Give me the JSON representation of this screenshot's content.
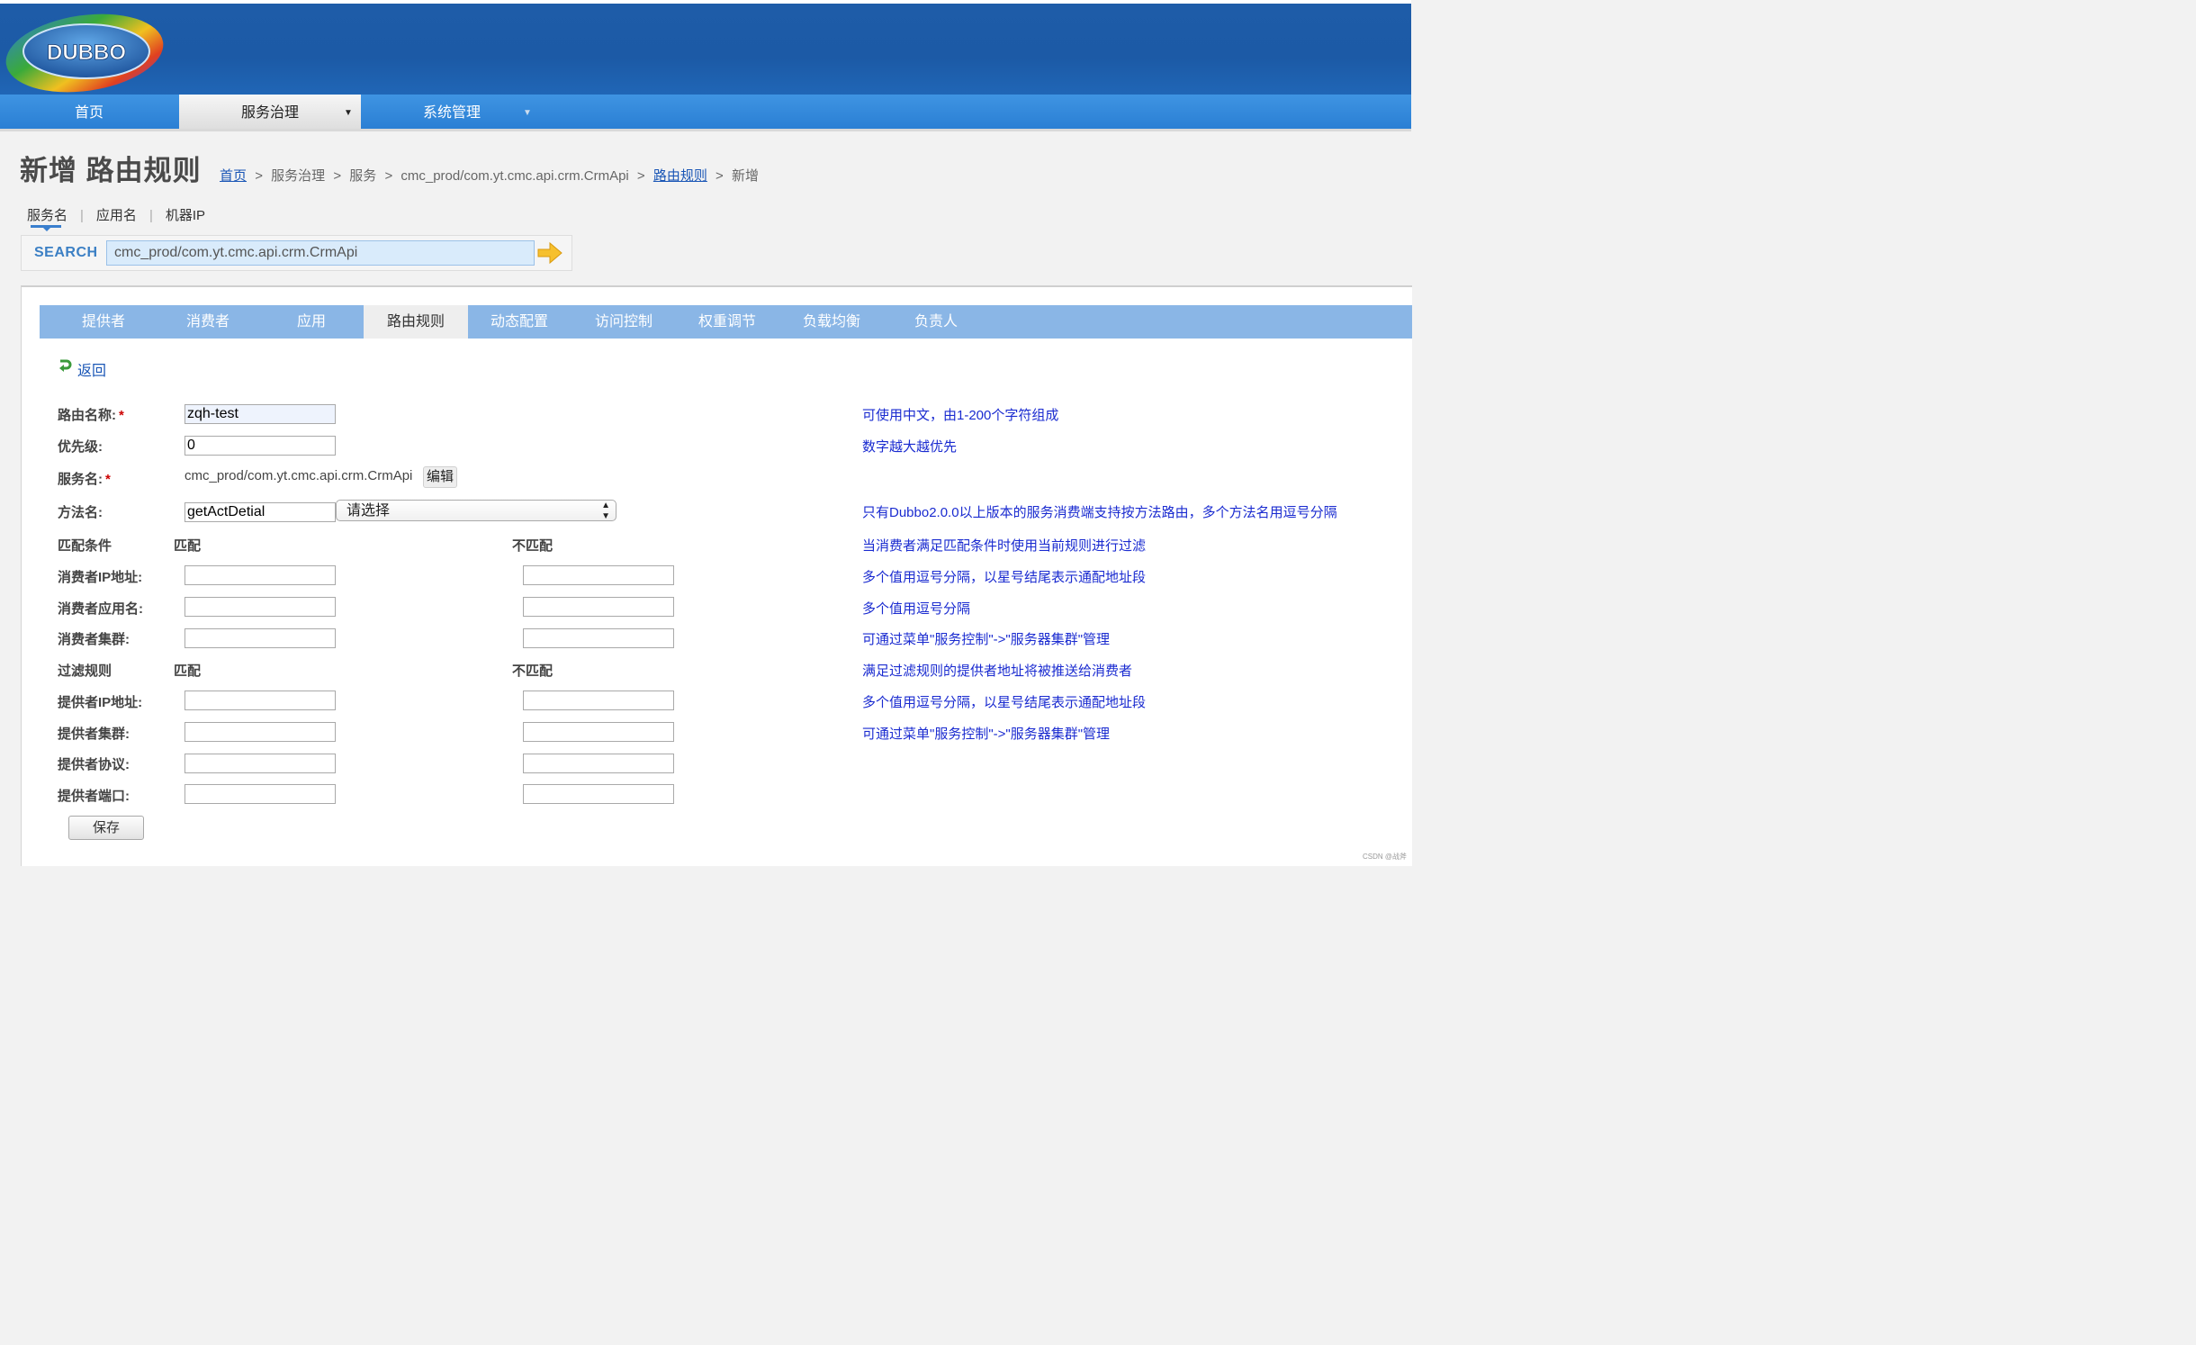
{
  "brand": {
    "logo_text": "DUBBO"
  },
  "nav": {
    "items": [
      {
        "label": "首页"
      },
      {
        "label": "服务治理"
      },
      {
        "label": "系统管理"
      }
    ]
  },
  "page": {
    "title": "新增 路由规则"
  },
  "breadcrumb": {
    "home": "首页",
    "governance": "服务治理",
    "service": "服务",
    "service_path": "cmc_prod/com.yt.cmc.api.crm.CrmApi",
    "routes": "路由规则",
    "current": "新增",
    "separator": ">"
  },
  "search": {
    "tabs": [
      "服务名",
      "应用名",
      "机器IP"
    ],
    "tab_separator": "|",
    "label": "SEARCH",
    "value": "cmc_prod/com.yt.cmc.api.crm.CrmApi"
  },
  "tabs": [
    "提供者",
    "消费者",
    "应用",
    "路由规则",
    "动态配置",
    "访问控制",
    "权重调节",
    "负载均衡",
    "负责人"
  ],
  "back": "返回",
  "form": {
    "required_mark": "*",
    "route_name": {
      "label": "路由名称:",
      "value": "zqh-test",
      "hint": "可使用中文，由1-200个字符组成"
    },
    "priority": {
      "label": "优先级:",
      "value": "0",
      "hint": "数字越大越优先"
    },
    "service": {
      "label": "服务名:",
      "value": "cmc_prod/com.yt.cmc.api.crm.CrmApi",
      "edit": "编辑"
    },
    "method": {
      "label": "方法名:",
      "value": "getActDetial",
      "select": "请选择",
      "hint": "只有Dubbo2.0.0以上版本的服务消费端支持按方法路由，多个方法名用逗号分隔"
    },
    "match": {
      "label": "匹配条件",
      "match": "匹配",
      "mismatch": "不匹配",
      "hint": "当消费者满足匹配条件时使用当前规则进行过滤"
    },
    "consumer_ip": {
      "label": "消费者IP地址:",
      "hint": "多个值用逗号分隔，以星号结尾表示通配地址段"
    },
    "consumer_app": {
      "label": "消费者应用名:",
      "hint": "多个值用逗号分隔"
    },
    "consumer_cluster": {
      "label": "消费者集群:",
      "hint": "可通过菜单\"服务控制\"->\"服务器集群\"管理"
    },
    "filter": {
      "label": "过滤规则",
      "match": "匹配",
      "mismatch": "不匹配",
      "hint": "满足过滤规则的提供者地址将被推送给消费者"
    },
    "provider_ip": {
      "label": "提供者IP地址:",
      "hint": "多个值用逗号分隔，以星号结尾表示通配地址段"
    },
    "provider_cluster": {
      "label": "提供者集群:",
      "hint": "可通过菜单\"服务控制\"->\"服务器集群\"管理"
    },
    "provider_protocol": {
      "label": "提供者协议:"
    },
    "provider_port": {
      "label": "提供者端口:"
    },
    "save": "保存"
  },
  "watermark": "CSDN @战斧"
}
